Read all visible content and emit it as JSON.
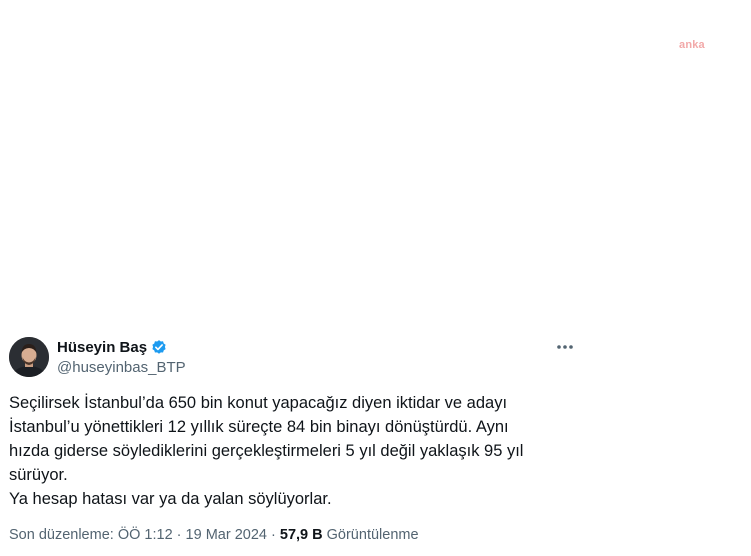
{
  "watermark": "anka",
  "tweet": {
    "display_name": "Hüseyin Baş",
    "handle": "@huseyinbas_BTP",
    "lines": [
      "Seçilirsek İstanbul’da 650 bin konut yapacağız diyen iktidar ve adayı",
      "İstanbul’u yönettikleri 12 yıllık süreçte 84 bin binayı dönüştürdü. Aynı",
      "hızda giderse söylediklerini gerçekleştirmeleri 5 yıl değil yaklaşık 95 yıl",
      "sürüyor.",
      "Ya hesap hatası var ya da yalan söylüyorlar."
    ],
    "edited_label": "Son düzenleme: ÖÖ 1:12",
    "separator": "·",
    "date": "19 Mar 2024",
    "views_count": "57,9 B",
    "views_label": "Görüntülenme"
  },
  "colors": {
    "verified": "#1d9bf0",
    "secondary_text": "#536471",
    "primary_text": "#0f1419",
    "watermark": "#f2a8a8"
  },
  "icons": {
    "verified": "verified-badge-icon",
    "more": "more-horizontal-icon"
  }
}
